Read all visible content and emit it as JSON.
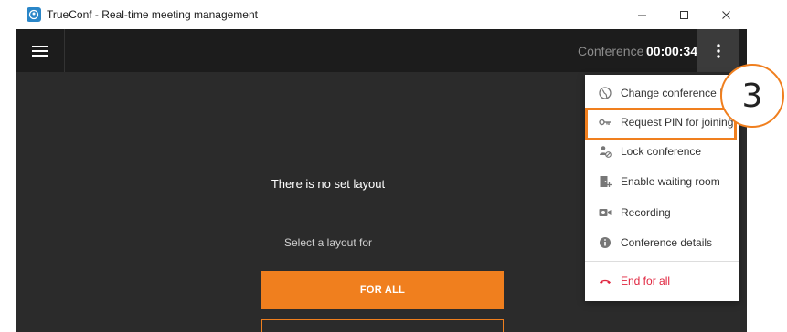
{
  "window": {
    "title": "TrueConf - Real-time meeting management",
    "controls": {
      "minimize": "–",
      "maximize": "☐",
      "close": "✕"
    }
  },
  "topbar": {
    "conference_label": "Conference",
    "timer": "00:00:34"
  },
  "stage": {
    "no_layout_text": "There is no set layout",
    "select_for_text": "Select a layout for",
    "for_all_button": "FOR ALL"
  },
  "menu": {
    "items": [
      {
        "label": "Change conference ID",
        "icon": "globe-icon"
      },
      {
        "label": "Request PIN for joining",
        "icon": "key-icon"
      },
      {
        "label": "Lock conference",
        "icon": "lock-user-icon"
      },
      {
        "label": "Enable waiting room",
        "icon": "door-icon"
      },
      {
        "label": "Recording",
        "icon": "camera-icon"
      },
      {
        "label": "Conference details",
        "icon": "info-icon"
      },
      {
        "label": "End for all",
        "icon": "hangup-icon"
      }
    ]
  },
  "annotation": {
    "step_number": "3"
  },
  "colors": {
    "accent": "#f07f1e",
    "danger": "#e0253f",
    "dark_bg": "#2b2b2b",
    "topbar_bg": "#1c1c1c"
  }
}
